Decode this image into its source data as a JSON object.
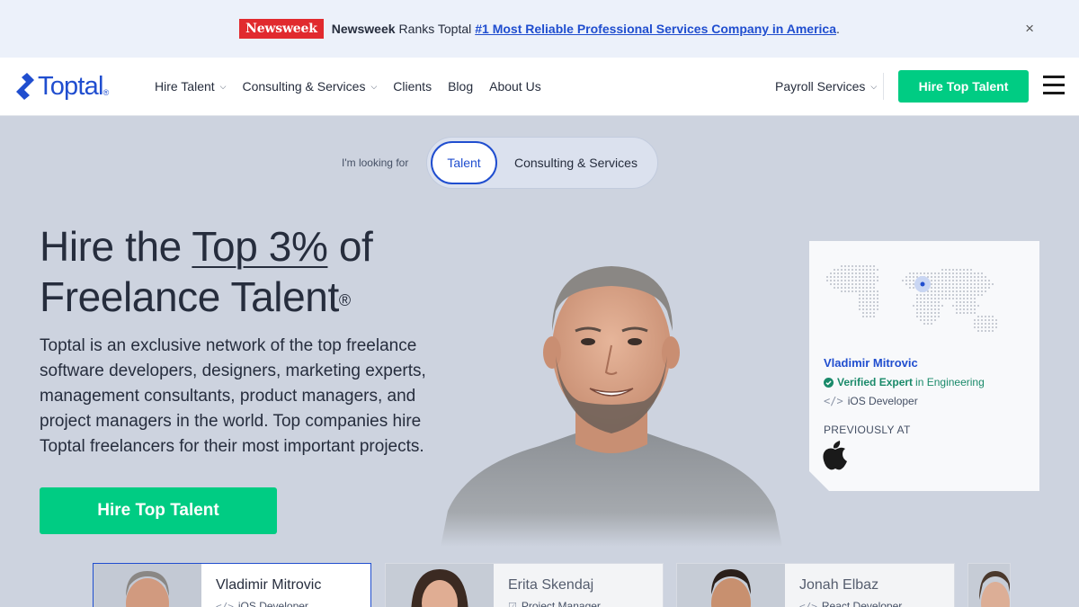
{
  "announcement": {
    "logo": "Newsweek",
    "brand": "Newsweek",
    "text": "Ranks Toptal",
    "link": "#1 Most Reliable Professional Services Company in America",
    "suffix": ".",
    "close": "×"
  },
  "header": {
    "logo_text": "Toptal",
    "logo_mark": "®",
    "nav": [
      {
        "label": "Hire Talent",
        "dropdown": true
      },
      {
        "label": "Consulting & Services",
        "dropdown": true
      },
      {
        "label": "Clients",
        "dropdown": false
      },
      {
        "label": "Blog",
        "dropdown": false
      },
      {
        "label": "About Us",
        "dropdown": false
      }
    ],
    "payroll": "Payroll Services",
    "cta": "Hire Top Talent",
    "menu_icon": "hamburger-icon"
  },
  "toggle": {
    "label": "I'm looking for",
    "options": [
      "Talent",
      "Consulting & Services"
    ],
    "selected": "Talent"
  },
  "hero": {
    "title_pre": "Hire the ",
    "title_highlight": "Top 3%",
    "title_post": " of",
    "title_line2": "Freelance Talent",
    "title_mark": "®",
    "description": "Toptal is an exclusive network of the top freelance software developers, designers, marketing experts, management consultants, product managers, and project managers in the world. Top companies hire Toptal freelancers for their most important projects.",
    "cta": "Hire Top Talent"
  },
  "expert": {
    "name": "Vladimir Mitrovic",
    "verified_label": "Verified Expert",
    "verified_suffix": "in Engineering",
    "role": "iOS Developer",
    "previously": "PREVIOUSLY AT",
    "company_icon": "apple-logo-icon"
  },
  "talent_cards": [
    {
      "name": "Vladimir Mitrovic",
      "role": "iOS Developer",
      "active": true
    },
    {
      "name": "Erita Skendaj",
      "role": "Project Manager",
      "active": false
    },
    {
      "name": "Jonah Elbaz",
      "role": "React Developer",
      "active": false
    }
  ],
  "colors": {
    "brand_blue": "#204ecf",
    "cta_green": "#00cc83",
    "hero_bg": "#cdd3df",
    "announce_bg": "#ecf1fa",
    "newsweek_red": "#e12a2e"
  }
}
